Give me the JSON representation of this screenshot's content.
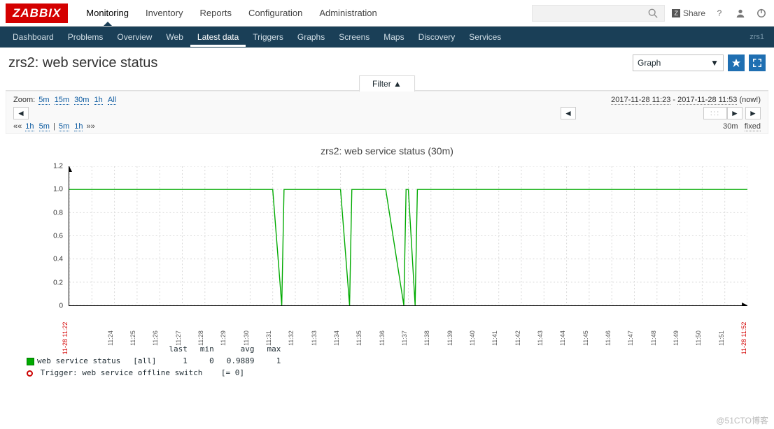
{
  "brand": "ZABBIX",
  "topnav": [
    "Monitoring",
    "Inventory",
    "Reports",
    "Configuration",
    "Administration"
  ],
  "topnav_active": "Monitoring",
  "share": "Share",
  "search_placeholder": "",
  "subnav": [
    "Dashboard",
    "Problems",
    "Overview",
    "Web",
    "Latest data",
    "Triggers",
    "Graphs",
    "Screens",
    "Maps",
    "Discovery",
    "Services"
  ],
  "subnav_active": "Latest data",
  "host_label": "zrs1",
  "page_title": "zrs2: web service status",
  "view_select": "Graph",
  "filter_label": "Filter ▲",
  "zoom_label": "Zoom:",
  "zoom_opts": [
    "5m",
    "15m",
    "30m",
    "1h",
    "All"
  ],
  "range_from": "2017-11-28 11:23",
  "range_to": "2017-11-28 11:53",
  "now_label": "(now!)",
  "nav_left": [
    "««",
    "1h",
    "5m",
    "|",
    "5m",
    "1h",
    "»»"
  ],
  "nav_right_dur": "30m",
  "nav_right_mode": "fixed",
  "chart_data": {
    "type": "line",
    "title": "zrs2: web service status (30m)",
    "ylabel": "",
    "xlabel": "",
    "ylim": [
      0,
      1.2
    ],
    "yticks": [
      0,
      0.2,
      0.4,
      0.6,
      0.8,
      1.0,
      1.2
    ],
    "x_start_label": "11-28 11:22",
    "x_end_label": "11-28 11:52",
    "xticks": [
      "11:24",
      "11:25",
      "11:26",
      "11:27",
      "11:28",
      "11:29",
      "11:30",
      "11:31",
      "11:32",
      "11:33",
      "11:34",
      "11:35",
      "11:36",
      "11:37",
      "11:38",
      "11:39",
      "11:40",
      "11:41",
      "11:42",
      "11:43",
      "11:44",
      "11:45",
      "11:46",
      "11:47",
      "11:48",
      "11:49",
      "11:50",
      "11:51"
    ],
    "series": [
      {
        "name": "web service status",
        "color": "#00aa00",
        "x": [
          0,
          1,
          2,
          3,
          4,
          5,
          6,
          7,
          8,
          9,
          9.4,
          9.5,
          10,
          11,
          12,
          12.4,
          12.5,
          13,
          14,
          14.8,
          14.9,
          15,
          15.3,
          15.4,
          16,
          17,
          18,
          19,
          20,
          21,
          22,
          23,
          24,
          25,
          26,
          27,
          28,
          29,
          30
        ],
        "y": [
          1,
          1,
          1,
          1,
          1,
          1,
          1,
          1,
          1,
          1,
          0,
          1,
          1,
          1,
          1,
          0,
          1,
          1,
          1,
          0,
          1,
          1,
          0,
          1,
          1,
          1,
          1,
          1,
          1,
          1,
          1,
          1,
          1,
          1,
          1,
          1,
          1,
          1,
          1
        ]
      }
    ],
    "legend": {
      "headers": [
        "",
        "",
        "last",
        "min",
        "avg",
        "max"
      ],
      "rows": [
        {
          "swatch": "green",
          "name": "web service status",
          "group": "[all]",
          "last": "1",
          "min": "0",
          "avg": "0.9889",
          "max": "1"
        }
      ],
      "trigger": {
        "name": "Trigger: web service offline switch",
        "cond": "[= 0]"
      }
    }
  },
  "watermark": "@51CTO博客"
}
